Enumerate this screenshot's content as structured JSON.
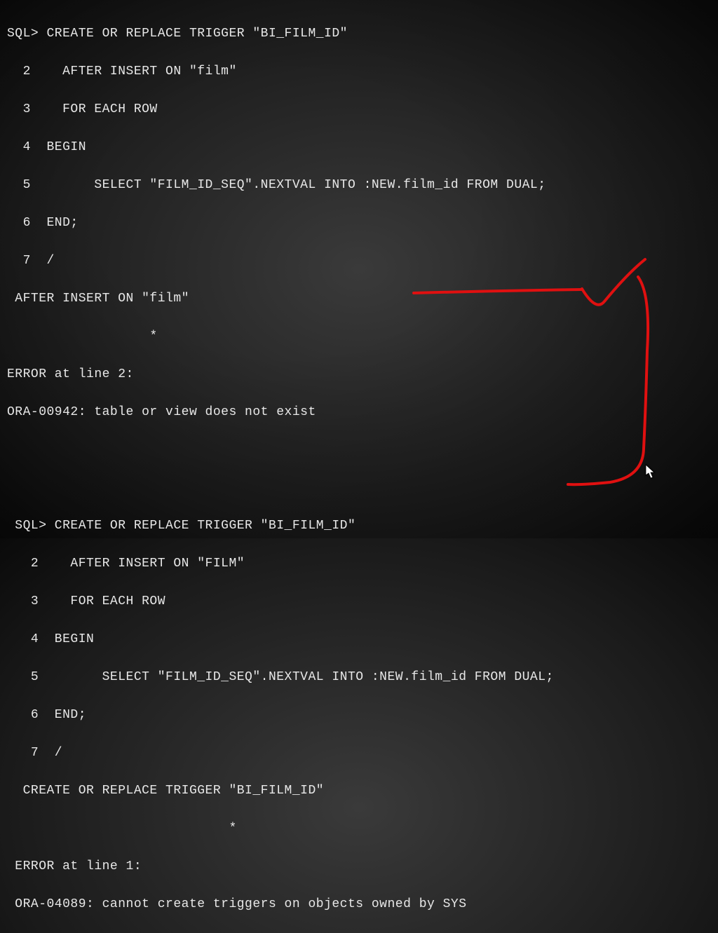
{
  "terminal": {
    "block1": {
      "l1": "SQL> CREATE OR REPLACE TRIGGER \"BI_FILM_ID\"",
      "l2": "  2    AFTER INSERT ON \"film\"",
      "l3": "  3    FOR EACH ROW",
      "l4": "  4  BEGIN",
      "l5": "  5        SELECT \"FILM_ID_SEQ\".NEXTVAL INTO :NEW.film_id FROM DUAL;",
      "l6": "  6  END;",
      "l7": "  7  /",
      "l8": " AFTER INSERT ON \"film\"",
      "l9": "                  *",
      "l10": "ERROR at line 2:",
      "l11": "ORA-00942: table or view does not exist"
    },
    "block2": {
      "l1": " SQL> CREATE OR REPLACE TRIGGER \"BI_FILM_ID\"",
      "l2": "   2    AFTER INSERT ON \"FILM\"",
      "l3": "   3    FOR EACH ROW",
      "l4": "   4  BEGIN",
      "l5": "   5        SELECT \"FILM_ID_SEQ\".NEXTVAL INTO :NEW.film_id FROM DUAL;",
      "l6": "   6  END;",
      "l7": "   7  /",
      "l8": "  CREATE OR REPLACE TRIGGER \"BI_FILM_ID\"",
      "l9": "                            *",
      "l10": " ERROR at line 1:",
      "l11": " ORA-04089: cannot create triggers on objects owned by SYS"
    }
  },
  "annotation": {
    "color": "#e01010",
    "description": "hand-drawn checkmark and bracket annotation"
  }
}
